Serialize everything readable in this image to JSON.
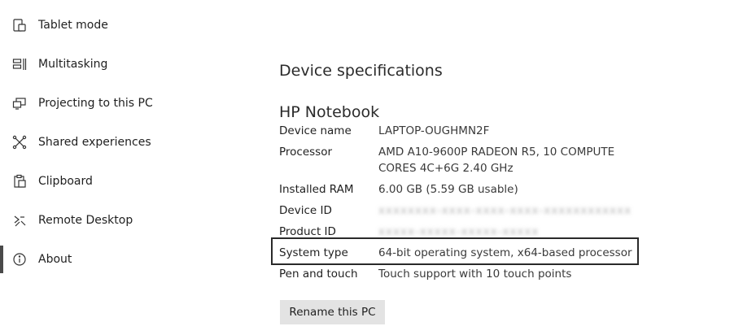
{
  "sidebar": {
    "items": [
      {
        "label": "Tablet mode",
        "icon": "tablet-mode-icon"
      },
      {
        "label": "Multitasking",
        "icon": "multitasking-icon"
      },
      {
        "label": "Projecting to this PC",
        "icon": "projecting-icon"
      },
      {
        "label": "Shared experiences",
        "icon": "shared-experiences-icon"
      },
      {
        "label": "Clipboard",
        "icon": "clipboard-icon"
      },
      {
        "label": "Remote Desktop",
        "icon": "remote-desktop-icon"
      },
      {
        "label": "About",
        "icon": "about-icon",
        "active": true
      }
    ]
  },
  "main": {
    "section_title": "Device specifications",
    "device_heading": "HP Notebook",
    "specs": [
      {
        "label": "Device name",
        "value": "LAPTOP-OUGHMN2F"
      },
      {
        "label": "Processor",
        "value_line1": "AMD A10-9600P RADEON R5, 10 COMPUTE",
        "value_line2": "CORES 4C+6G   2.40 GHz"
      },
      {
        "label": "Installed RAM",
        "value": "6.00 GB (5.59 GB usable)"
      },
      {
        "label": "Device ID",
        "value": "xxxxxxxx-xxxx-xxxx-xxxx-xxxxxxxxxxxx"
      },
      {
        "label": "Product ID",
        "value": "xxxxx-xxxxx-xxxxx-xxxxx"
      },
      {
        "label": "System type",
        "value": "64-bit operating system, x64-based processor"
      },
      {
        "label": "Pen and touch",
        "value": "Touch support with 10 touch points"
      }
    ],
    "rename_button": "Rename this PC"
  },
  "colors": {
    "active_indicator": "#4a4a4a",
    "button_bg": "#e3e3e3",
    "highlight_border": "#2a2a2a"
  }
}
